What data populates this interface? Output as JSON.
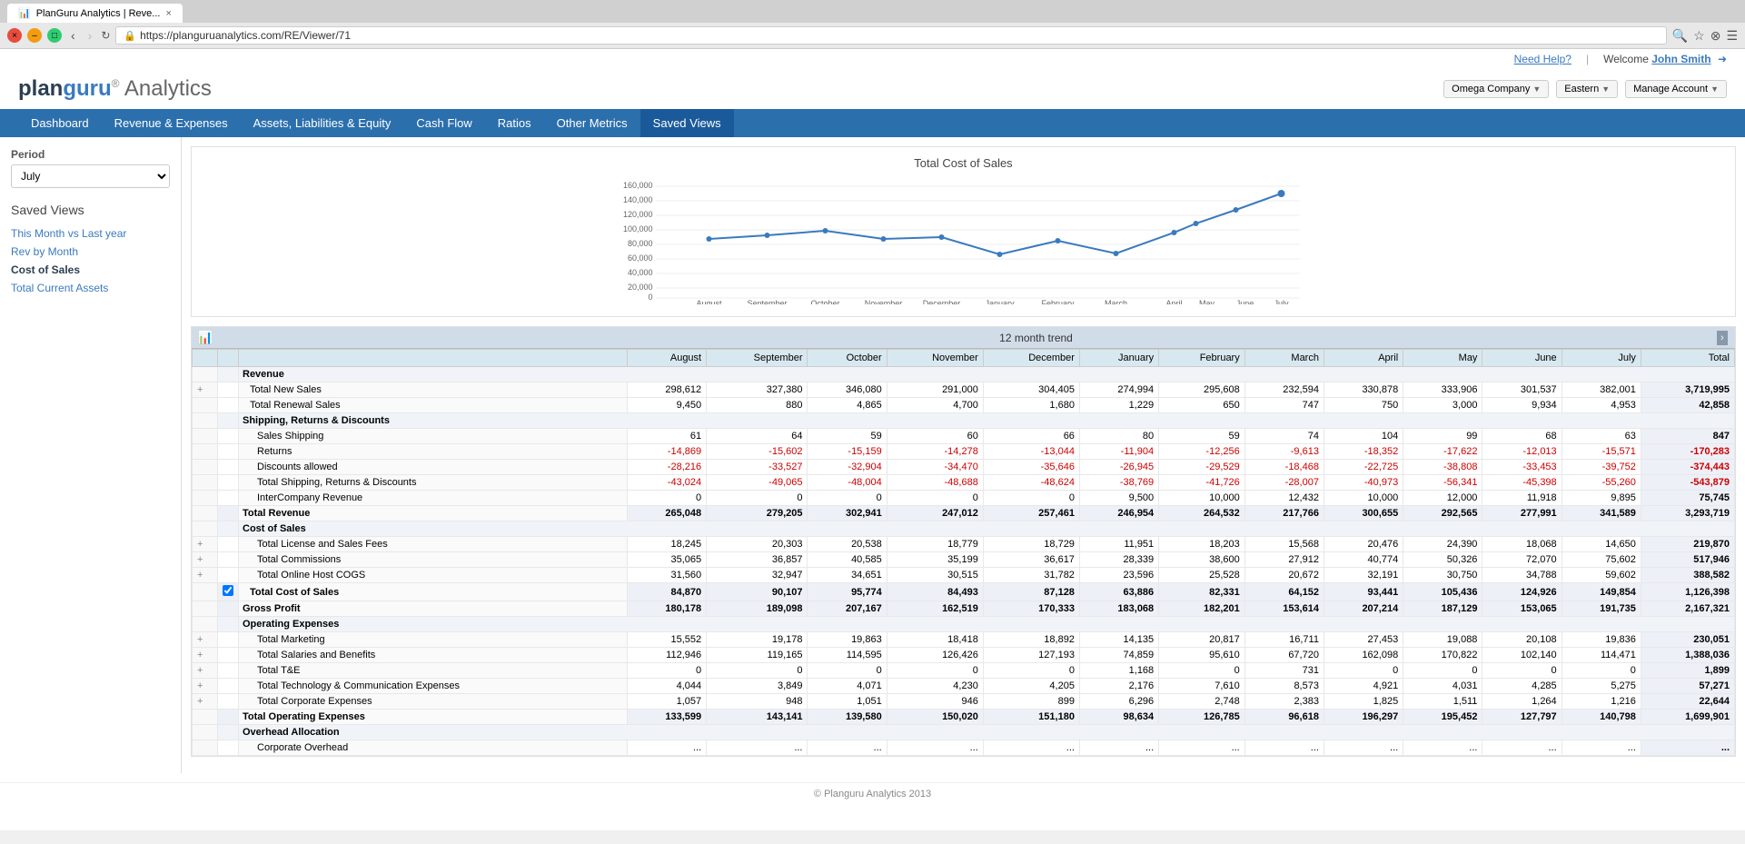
{
  "browser": {
    "tab_title": "PlanGuru Analytics | Reve...",
    "url": "https://planguruanalytics.com/RE/Viewer/71",
    "close_icon": "×",
    "back_icon": "‹",
    "forward_icon": "›",
    "refresh_icon": "↻"
  },
  "header": {
    "logo_plan": "plan",
    "logo_guru": "guru",
    "logo_reg": "®",
    "logo_analytics": " Analytics",
    "need_help": "Need Help?",
    "welcome": "Welcome ",
    "user_name": "John Smith",
    "company_selector": "Omega Company",
    "region_selector": "Eastern",
    "account_selector": "Manage Account"
  },
  "nav": {
    "items": [
      {
        "label": "Dashboard",
        "active": false
      },
      {
        "label": "Revenue & Expenses",
        "active": false
      },
      {
        "label": "Assets, Liabilities & Equity",
        "active": false
      },
      {
        "label": "Cash Flow",
        "active": false
      },
      {
        "label": "Ratios",
        "active": false
      },
      {
        "label": "Other Metrics",
        "active": false
      },
      {
        "label": "Saved Views",
        "active": true
      }
    ]
  },
  "sidebar": {
    "period_label": "Period",
    "period_value": "July",
    "saved_views_title": "Saved Views",
    "saved_view_items": [
      {
        "label": "This Month vs Last year",
        "active": false
      },
      {
        "label": "Rev by Month",
        "active": false
      },
      {
        "label": "Cost of Sales",
        "active": true
      },
      {
        "label": "Total Current Assets",
        "active": false
      }
    ]
  },
  "chart": {
    "title": "Total Cost of Sales",
    "trend_label": "12 month trend",
    "months": [
      "August",
      "September",
      "October",
      "November",
      "December",
      "January",
      "February",
      "March",
      "April",
      "May",
      "June",
      "July"
    ],
    "values": [
      84870,
      90107,
      95774,
      84493,
      87128,
      63886,
      82331,
      64152,
      93441,
      105436,
      124926,
      149854
    ],
    "y_labels": [
      "160,000",
      "140,000",
      "120,000",
      "100,000",
      "80,000",
      "60,000",
      "40,000",
      "20,000",
      "0"
    ]
  },
  "table": {
    "columns": [
      "August",
      "September",
      "October",
      "November",
      "December",
      "January",
      "February",
      "March",
      "April",
      "May",
      "June",
      "July",
      "Total"
    ],
    "rows": [
      {
        "type": "section",
        "label": "Revenue",
        "indent": 0
      },
      {
        "type": "data",
        "label": "Total New Sales",
        "indent": 1,
        "expand": true,
        "values": [
          "298,612",
          "327,380",
          "346,080",
          "291,000",
          "304,405",
          "274,994",
          "295,608",
          "232,594",
          "330,878",
          "333,906",
          "301,537",
          "382,001",
          "3,719,995"
        ]
      },
      {
        "type": "data",
        "label": "Total Renewal Sales",
        "indent": 1,
        "values": [
          "9,450",
          "880",
          "4,865",
          "4,700",
          "1,680",
          "1,229",
          "650",
          "747",
          "750",
          "3,000",
          "9,934",
          "4,953",
          "42,858"
        ]
      },
      {
        "type": "section-sub",
        "label": "Shipping, Returns & Discounts",
        "indent": 0
      },
      {
        "type": "data",
        "label": "Sales Shipping",
        "indent": 2,
        "values": [
          "61",
          "64",
          "59",
          "60",
          "66",
          "80",
          "59",
          "74",
          "104",
          "99",
          "68",
          "63",
          "847"
        ]
      },
      {
        "type": "data",
        "label": "Returns",
        "indent": 2,
        "values": [
          "-14,869",
          "-15,602",
          "-15,159",
          "-14,278",
          "-13,044",
          "-11,904",
          "-12,256",
          "-9,613",
          "-18,352",
          "-17,622",
          "-12,013",
          "-15,571",
          "-170,283"
        ]
      },
      {
        "type": "data",
        "label": "Discounts allowed",
        "indent": 2,
        "values": [
          "-28,216",
          "-33,527",
          "-32,904",
          "-34,470",
          "-35,646",
          "-26,945",
          "-29,529",
          "-18,468",
          "-22,725",
          "-38,808",
          "-33,453",
          "-39,752",
          "-374,443"
        ]
      },
      {
        "type": "data",
        "label": "Total Shipping, Returns & Discounts",
        "indent": 2,
        "values": [
          "-43,024",
          "-49,065",
          "-48,004",
          "-48,688",
          "-48,624",
          "-38,769",
          "-41,726",
          "-28,007",
          "-40,973",
          "-56,341",
          "-45,398",
          "-55,260",
          "-543,879"
        ]
      },
      {
        "type": "data",
        "label": "InterCompany Revenue",
        "indent": 2,
        "values": [
          "0",
          "0",
          "0",
          "0",
          "0",
          "9,500",
          "10,000",
          "12,432",
          "10,000",
          "12,000",
          "11,918",
          "9,895",
          "75,745"
        ]
      },
      {
        "type": "total",
        "label": "Total Revenue",
        "indent": 0,
        "values": [
          "265,048",
          "279,205",
          "302,941",
          "247,012",
          "257,461",
          "246,954",
          "264,532",
          "217,766",
          "300,655",
          "292,565",
          "277,991",
          "341,589",
          "3,293,719"
        ]
      },
      {
        "type": "section",
        "label": "Cost of Sales",
        "indent": 0
      },
      {
        "type": "data",
        "label": "Total License and Sales Fees",
        "indent": 2,
        "expand": true,
        "values": [
          "18,245",
          "20,303",
          "20,538",
          "18,779",
          "18,729",
          "11,951",
          "18,203",
          "15,568",
          "20,476",
          "24,390",
          "18,068",
          "14,650",
          "219,870"
        ]
      },
      {
        "type": "data",
        "label": "Total Commissions",
        "indent": 2,
        "expand": true,
        "values": [
          "35,065",
          "36,857",
          "40,585",
          "35,199",
          "36,617",
          "28,339",
          "38,600",
          "27,912",
          "40,774",
          "50,326",
          "72,070",
          "75,602",
          "517,946"
        ]
      },
      {
        "type": "data",
        "label": "Total Online Host COGS",
        "indent": 2,
        "expand": true,
        "values": [
          "31,560",
          "32,947",
          "34,651",
          "30,515",
          "31,782",
          "23,596",
          "25,528",
          "20,672",
          "32,191",
          "30,750",
          "34,788",
          "59,602",
          "388,582"
        ]
      },
      {
        "type": "total",
        "label": "Total Cost of Sales",
        "indent": 1,
        "checkbox": true,
        "values": [
          "84,870",
          "90,107",
          "95,774",
          "84,493",
          "87,128",
          "63,886",
          "82,331",
          "64,152",
          "93,441",
          "105,436",
          "124,926",
          "149,854",
          "1,126,398"
        ]
      },
      {
        "type": "total",
        "label": "Gross Profit",
        "indent": 0,
        "values": [
          "180,178",
          "189,098",
          "207,167",
          "162,519",
          "170,333",
          "183,068",
          "182,201",
          "153,614",
          "207,214",
          "187,129",
          "153,065",
          "191,735",
          "2,167,321"
        ]
      },
      {
        "type": "section",
        "label": "Operating Expenses",
        "indent": 0
      },
      {
        "type": "data",
        "label": "Total Marketing",
        "indent": 2,
        "expand": true,
        "values": [
          "15,552",
          "19,178",
          "19,863",
          "18,418",
          "18,892",
          "14,135",
          "20,817",
          "16,711",
          "27,453",
          "19,088",
          "20,108",
          "19,836",
          "230,051"
        ]
      },
      {
        "type": "data",
        "label": "Total Salaries and Benefits",
        "indent": 2,
        "expand": true,
        "values": [
          "112,946",
          "119,165",
          "114,595",
          "126,426",
          "127,193",
          "74,859",
          "95,610",
          "67,720",
          "162,098",
          "170,822",
          "102,140",
          "114,471",
          "1,388,036"
        ]
      },
      {
        "type": "data",
        "label": "Total T&E",
        "indent": 2,
        "expand": true,
        "values": [
          "0",
          "0",
          "0",
          "0",
          "0",
          "1,168",
          "0",
          "731",
          "0",
          "0",
          "0",
          "0",
          "1,899"
        ]
      },
      {
        "type": "data",
        "label": "Total Technology & Communication Expenses",
        "indent": 2,
        "expand": true,
        "values": [
          "4,044",
          "3,849",
          "4,071",
          "4,230",
          "4,205",
          "2,176",
          "7,610",
          "8,573",
          "4,921",
          "4,031",
          "4,285",
          "5,275",
          "57,271"
        ]
      },
      {
        "type": "data",
        "label": "Total Corporate Expenses",
        "indent": 2,
        "expand": true,
        "values": [
          "1,057",
          "948",
          "1,051",
          "946",
          "899",
          "6,296",
          "2,748",
          "2,383",
          "1,825",
          "1,511",
          "1,264",
          "1,216",
          "22,644"
        ]
      },
      {
        "type": "total",
        "label": "Total Operating Expenses",
        "indent": 0,
        "values": [
          "133,599",
          "143,141",
          "139,580",
          "150,020",
          "151,180",
          "98,634",
          "126,785",
          "96,618",
          "196,297",
          "195,452",
          "127,797",
          "140,798",
          "1,699,901"
        ]
      },
      {
        "type": "section",
        "label": "Overhead Allocation",
        "indent": 0
      },
      {
        "type": "data",
        "label": "Corporate Overhead",
        "indent": 2,
        "values": [
          "...",
          "...",
          "...",
          "...",
          "...",
          "...",
          "...",
          "...",
          "...",
          "...",
          "...",
          "...",
          "..."
        ]
      }
    ]
  },
  "footer": {
    "copyright": "© Planguru Analytics 2013"
  }
}
